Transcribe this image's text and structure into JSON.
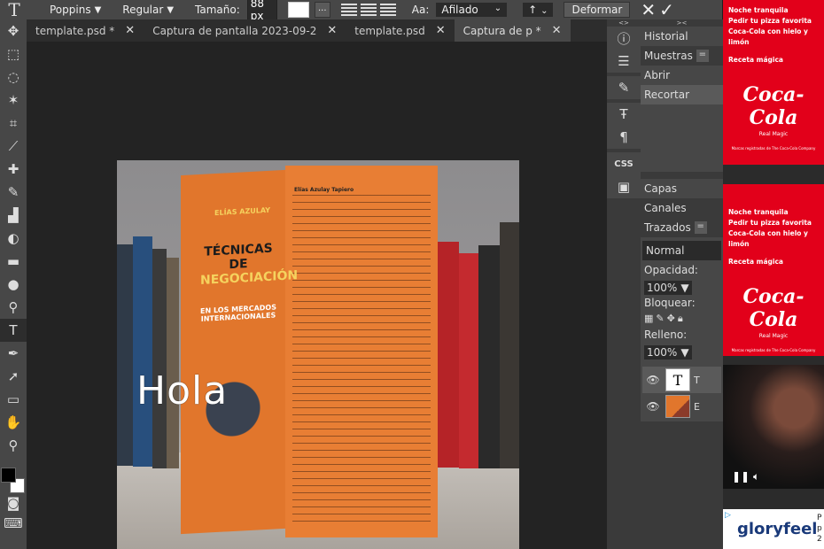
{
  "topbar": {
    "font_family": "Poppins",
    "font_style": "Regular",
    "size_label": "Tamaño:",
    "size_value": "88 px",
    "dots": "...",
    "aa_label": "Aa:",
    "aa_value": "Afilado",
    "arrow": "↑",
    "deform": "Deformar"
  },
  "tabs": [
    {
      "label": "template.psd *"
    },
    {
      "label": "Captura de pantalla 2023-09-2"
    },
    {
      "label": "template.psd"
    },
    {
      "label": "Captura de p *"
    }
  ],
  "canvas": {
    "text_layer": "Hola",
    "book_author": "ELÍAS AZULAY",
    "book_title_1": "TÉCNICAS DE",
    "book_title_2": "NEGOCIACIÓN",
    "book_subtitle": "EN LOS MERCADOS INTERNACIONALES",
    "back_author": "Elías Azulay Tapiero"
  },
  "panels": {
    "collapse_left": "<>",
    "collapse_right": "><",
    "history_tab": "Historial",
    "samples_tab": "Muestras",
    "history_items": [
      "Abrir",
      "Recortar"
    ],
    "layers_tab": "Capas",
    "channels_tab": "Canales",
    "paths_tab": "Trazados",
    "blend_mode": "Normal",
    "opacity_label": "Opacidad:",
    "opacity_value": "100%",
    "lock_label": "Bloquear:",
    "fill_label": "Relleno:",
    "fill_value": "100%",
    "layer_text_name": "T",
    "layer_image_name": "E"
  },
  "ads": {
    "ad1_lines": [
      "Noche tranquila",
      "Pedir tu pizza favorita",
      "Coca-Cola con hielo y limón"
    ],
    "ad1_recipe": "Receta mágica",
    "ad1_logo": "Coca-Cola",
    "ad1_tag": "Real Magic",
    "ad1_small": "Marcas registradas de The Coca-Cola Company",
    "ad2_lines": [
      "Noche tranquila",
      "Pedir tu pizza favorita",
      "Coca-Cola con hielo y limón"
    ],
    "ad2_recipe": "Receta mágica",
    "ad2_logo": "Coca-Cola",
    "ad2_tag": "Real Magic",
    "ad2_small": "Marcas registradas de The Coca-Cola Company",
    "banner_brand": "gloryfeel",
    "banner_side": [
      "P",
      "p",
      "2"
    ]
  },
  "icons": {
    "text_tool": "T",
    "close": "✕",
    "check": "✓"
  }
}
